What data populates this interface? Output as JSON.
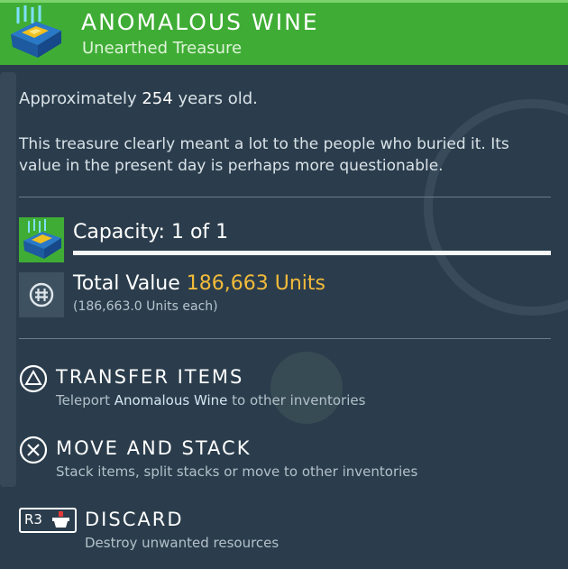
{
  "item": {
    "name": "ANOMALOUS WINE",
    "category": "Unearthed Treasure",
    "age_prefix": "Approximately ",
    "age_value": "254",
    "age_suffix": " years old.",
    "description": "This treasure clearly meant a lot to the people who buried it. Its value in the present day is perhaps more questionable."
  },
  "capacity": {
    "label": "Capacity: 1 of 1",
    "fill_fraction": 1.0
  },
  "value": {
    "label": "Total Value ",
    "amount": "186,663 Units",
    "each": "(186,663.0 Units each)"
  },
  "actions": [
    {
      "title": "TRANSFER ITEMS",
      "sub_prefix": "Teleport ",
      "sub_highlight": "Anomalous Wine",
      "sub_suffix": " to other inventories",
      "icon": "triangle-button-icon"
    },
    {
      "title": "MOVE AND STACK",
      "sub": "Stack items, split stacks or move to other inventories",
      "icon": "cross-button-icon"
    },
    {
      "title": "DISCARD",
      "sub": "Destroy unwanted resources",
      "button_label": "R3",
      "icon": "r3-button-icon"
    }
  ],
  "colors": {
    "header": "#3fad35",
    "accent_value": "#f3bb3a",
    "background": "#2b3d4c"
  }
}
